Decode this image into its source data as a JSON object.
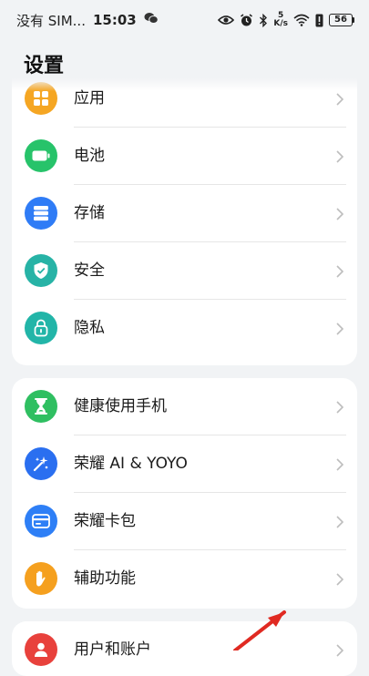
{
  "status_bar": {
    "carrier": "没有 SIM...",
    "time": "15:03",
    "network_speed_value": "5",
    "network_speed_unit": "K/s",
    "battery_level": "56"
  },
  "page_title": "设置",
  "sections": [
    {
      "items": [
        {
          "label": "应用",
          "icon": "apps-grid-icon",
          "color": "#f5a623"
        },
        {
          "label": "电池",
          "icon": "battery-icon",
          "color": "#27c36a"
        },
        {
          "label": "存储",
          "icon": "storage-icon",
          "color": "#2f7cf6"
        },
        {
          "label": "安全",
          "icon": "shield-check-icon",
          "color": "#27b3a6"
        },
        {
          "label": "隐私",
          "icon": "privacy-lock-icon",
          "color": "#22b5a8"
        }
      ]
    },
    {
      "items": [
        {
          "label": "健康使用手机",
          "icon": "hourglass-icon",
          "color": "#2fbf61"
        },
        {
          "label": "荣耀 AI & YOYO",
          "icon": "ai-sparkle-icon",
          "color": "#2a6ff0"
        },
        {
          "label": "荣耀卡包",
          "icon": "wallet-card-icon",
          "color": "#2e7ff6"
        },
        {
          "label": "辅助功能",
          "icon": "hand-icon",
          "color": "#f5a01f"
        }
      ]
    },
    {
      "items": [
        {
          "label": "用户和账户",
          "icon": "user-icon",
          "color": "#e8413c"
        }
      ]
    }
  ]
}
